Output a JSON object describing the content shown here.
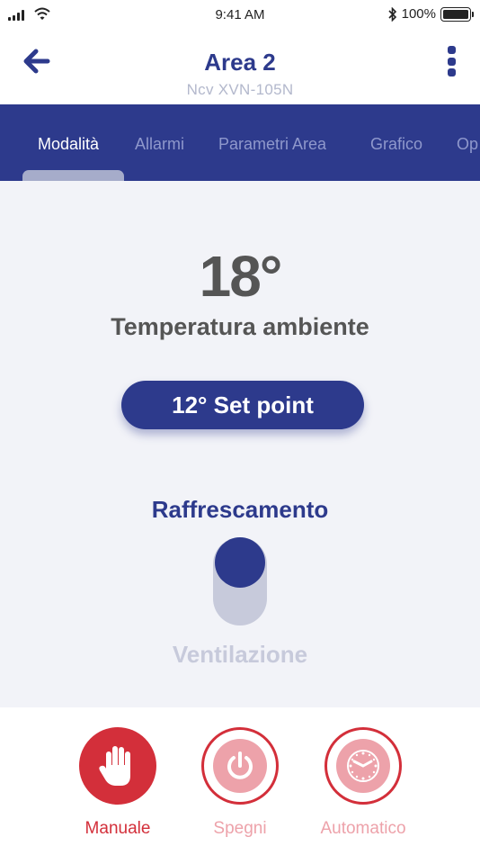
{
  "status_bar": {
    "time": "9:41 AM",
    "battery": "100%",
    "icons": [
      "signal-icon",
      "wifi-icon",
      "bluetooth-icon",
      "battery-icon"
    ]
  },
  "header": {
    "title": "Area 2",
    "subtitle": "Ncv XVN-105N",
    "back_icon": "arrow-left-icon",
    "menu_icon": "more-vertical-icon"
  },
  "tabs": [
    {
      "label": "Modalità",
      "active": true
    },
    {
      "label": "Allarmi",
      "active": false
    },
    {
      "label": "Parametri Area",
      "active": false
    },
    {
      "label": "Grafico",
      "active": false
    },
    {
      "label": "Op",
      "active": false
    }
  ],
  "main": {
    "temperature": "18°",
    "temperature_label": "Temperatura ambiente",
    "setpoint": "12° Set point",
    "mode_selected": "Raffrescamento",
    "mode_other": "Ventilazione"
  },
  "bottom_modes": [
    {
      "label": "Manuale",
      "icon": "hand-icon",
      "active": true
    },
    {
      "label": "Spegni",
      "icon": "power-icon",
      "active": false
    },
    {
      "label": "Automatico",
      "icon": "clock-icon",
      "active": false
    }
  ],
  "colors": {
    "primary": "#2d3a8c",
    "accent_red": "#d32f3a",
    "inactive_red": "#eda2aa",
    "muted": "#c7cadb",
    "background": "#f2f3f8"
  }
}
